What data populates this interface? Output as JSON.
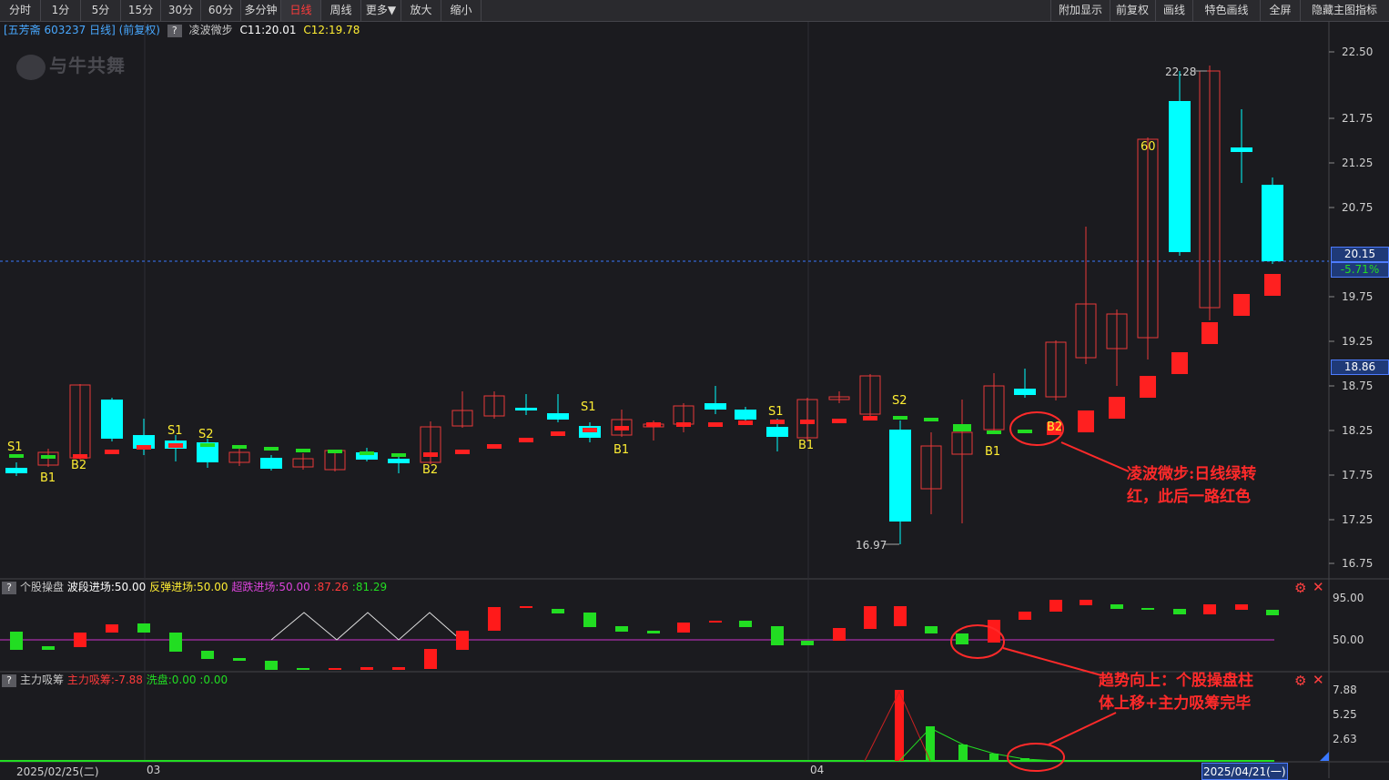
{
  "toolbar": {
    "periods": [
      "分时",
      "1分",
      "5分",
      "15分",
      "30分",
      "60分",
      "多分钟",
      "日线",
      "周线",
      "更多▼",
      "放大",
      "缩小"
    ],
    "active": "日线",
    "right": [
      "附加显示",
      "前复权",
      "画线",
      "特色画线",
      "全屏",
      "隐藏主图指标"
    ]
  },
  "main_info": {
    "stock": "[五芳斋 603237 日线] (前复权)",
    "indicator": "凌波微步",
    "c11": "C11:20.01",
    "c12": "C12:19.78"
  },
  "watermark": "与牛共舞",
  "price_axis": [
    "22.50",
    "21.75",
    "21.25",
    "20.75",
    "20.15",
    "-5.71%",
    "19.75",
    "19.25",
    "18.86",
    "18.75",
    "18.25",
    "17.75",
    "17.25",
    "16.75"
  ],
  "high_label": "22.28",
  "low_label": "16.97",
  "signals": [
    "S1",
    "B1",
    "B2",
    "S1",
    "S2",
    "B2",
    "S1",
    "B1",
    "S1",
    "B1",
    "S2",
    "B1",
    "B2",
    "60"
  ],
  "colors": {
    "up": "#ff2020",
    "down": "#00ffff",
    "green": "#22dd22",
    "magenta": "#cc33cc",
    "annotation": "#ff2a2a",
    "background": "#1b1b1f"
  },
  "panel2": {
    "name": "个股操盘",
    "wave": "波段进场:50.00",
    "rebound": "反弹进场:50.00",
    "oversold": "超跌进场:50.00",
    "v1": ":87.26",
    "v2": ":81.29",
    "axis": [
      "95.00",
      "50.00"
    ]
  },
  "panel3": {
    "name": "主力吸筹",
    "absorb": "主力吸筹:-7.88",
    "wash": "洗盘:0.00",
    "v": ":0.00",
    "axis": [
      "7.88",
      "5.25",
      "2.63"
    ]
  },
  "dates": {
    "start": "2025/02/25(二)",
    "m03": "03",
    "m04": "04",
    "end": "2025/04/21(一)"
  },
  "annotations": {
    "a1_line1": "凌波微步:日线绿转",
    "a1_line2": "红，此后一路红色",
    "a2_line1": "趋势向上：个股操盘柱",
    "a2_line2": "体上移+主力吸筹完毕"
  }
}
